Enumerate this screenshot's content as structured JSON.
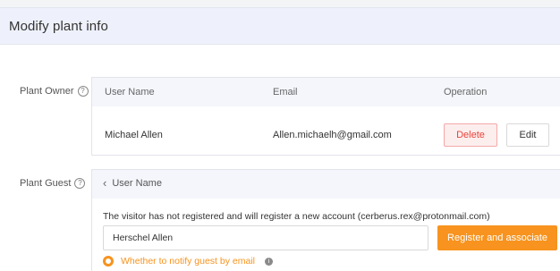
{
  "header": {
    "title": "Modify plant info"
  },
  "owner": {
    "label": "Plant Owner",
    "columns": {
      "user_name": "User Name",
      "email": "Email",
      "operation": "Operation"
    },
    "row": {
      "user_name": "Michael Allen",
      "email": "Allen.michaelh@gmail.com"
    },
    "delete_label": "Delete",
    "edit_label": "Edit"
  },
  "guest": {
    "label": "Plant Guest",
    "back_label": "User Name",
    "notice": "The visitor has not registered and will register a new account (cerberus.rex@protonmail.com)",
    "input_value": "Herschel Allen",
    "register_label": "Register and associate",
    "notify_label": "Whether to notify guest by email"
  },
  "icons": {
    "help": "question-circle-icon",
    "back": "chevron-left-icon",
    "info": "info-circle-icon",
    "radio": "radio-checked-icon"
  },
  "colors": {
    "accent": "#f7931e",
    "danger": "#e8443a",
    "header_bg": "#eef1fb"
  }
}
